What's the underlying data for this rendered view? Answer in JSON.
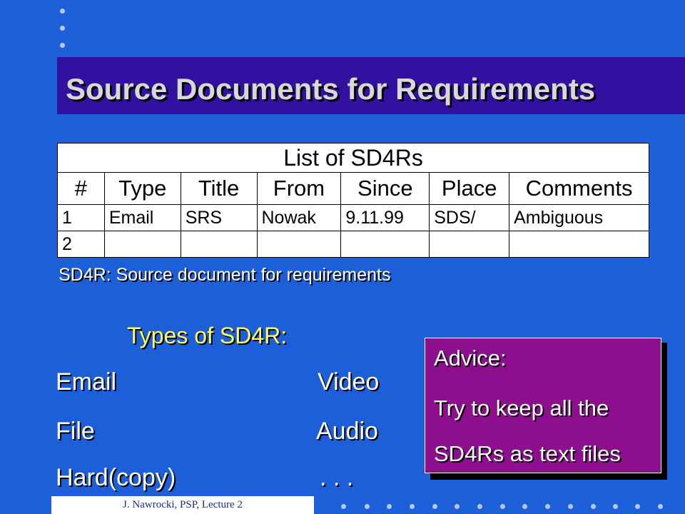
{
  "slide": {
    "title": "Source Documents for Requirements",
    "table": {
      "caption": "List of SD4Rs",
      "headers": [
        "#",
        "Type",
        "Title",
        "From",
        "Since",
        "Place",
        "Comments"
      ],
      "rows": [
        [
          "1",
          "Email",
          "SRS",
          "Nowak",
          "9.11.99",
          "SDS/",
          "Ambiguous"
        ],
        [
          "2",
          "",
          "",
          "",
          "",
          "",
          ""
        ]
      ]
    },
    "definition": "SD4R: Source document for requirements",
    "types_heading": "Types of SD4R:",
    "types": {
      "left": [
        "Email",
        "File",
        "Hard(copy)"
      ],
      "right": [
        "Video",
        "Audio",
        ". . ."
      ]
    },
    "advice": {
      "label": "Advice:",
      "line1": "Try to keep all the",
      "line2": "SD4Rs as text files"
    },
    "footer": "J. Nawrocki, PSP, Lecture 2"
  },
  "colors": {
    "background": "#1c5fd8",
    "title_bar": "#3311a0",
    "advice_box": "#8d0f8d",
    "types_heading": "#ffff5c"
  }
}
